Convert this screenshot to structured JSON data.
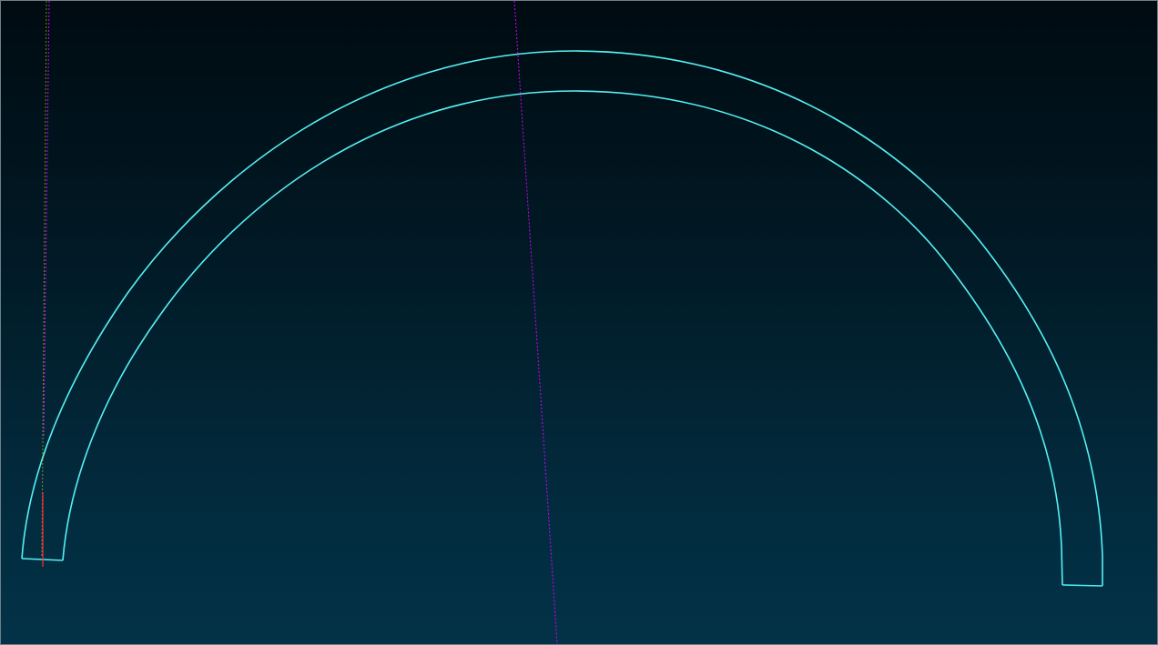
{
  "viewport": {
    "background_top": "#000b11",
    "background_bottom": "#033248"
  },
  "geometry": {
    "arch_color": "#56f0f5",
    "guide_magenta": "#d000ff",
    "guide_red": "#ff2a3a",
    "guide_yellow": "#e8e400"
  }
}
